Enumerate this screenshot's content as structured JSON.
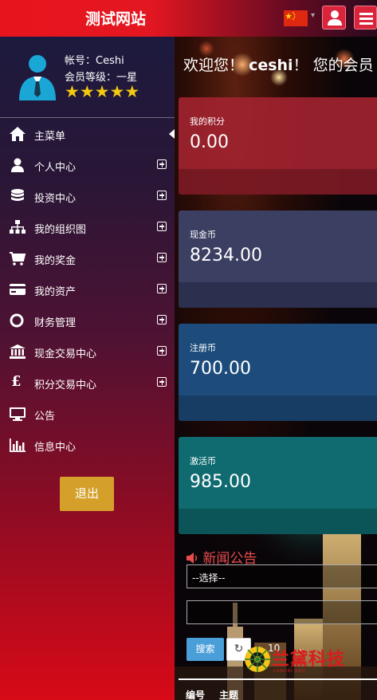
{
  "header": {
    "site_title": "测试网站"
  },
  "icons": {
    "flag": "china-flag-icon",
    "user": "user-icon",
    "menu": "hamburger-icon"
  },
  "profile": {
    "account_line": "帐号：Ceshi",
    "level_line": "会员等级：一星",
    "stars": 5
  },
  "sidebar": {
    "items": [
      {
        "label": "主菜单",
        "icon": "home-icon",
        "expandable": false,
        "active": true
      },
      {
        "label": "个人中心",
        "icon": "user-icon",
        "expandable": true
      },
      {
        "label": "投资中心",
        "icon": "database-icon",
        "expandable": true
      },
      {
        "label": "我的组织图",
        "icon": "sitemap-icon",
        "expandable": true
      },
      {
        "label": "我的奖金",
        "icon": "cart-icon",
        "expandable": true
      },
      {
        "label": "我的资产",
        "icon": "credit-card-icon",
        "expandable": true
      },
      {
        "label": "财务管理",
        "icon": "circle-icon",
        "expandable": true
      },
      {
        "label": "现金交易中心",
        "icon": "bank-icon",
        "expandable": true
      },
      {
        "label": "积分交易中心",
        "icon": "pound-icon",
        "expandable": true
      },
      {
        "label": "公告",
        "icon": "monitor-icon",
        "expandable": false
      },
      {
        "label": "信息中心",
        "icon": "bar-chart-icon",
        "expandable": false
      }
    ],
    "logout_label": "退出"
  },
  "main": {
    "welcome_prefix": "欢迎您！",
    "welcome_user": "ceshi",
    "welcome_suffix": "！  您的会员",
    "cards": [
      {
        "label": "我的积分",
        "value": "0.00",
        "color_top": "#a0232f",
        "color_bottom": "#7d1a25"
      },
      {
        "label": "现金币",
        "value": "8234.00",
        "color_top": "#3b3f62",
        "color_bottom": "#2c2f4d"
      },
      {
        "label": "注册币",
        "value": "700.00",
        "color_top": "#1d4c7c",
        "color_bottom": "#173d64"
      },
      {
        "label": "激活币",
        "value": "985.00",
        "color_top": "#0f6b70",
        "color_bottom": "#0b5558"
      }
    ],
    "news": {
      "title": "新闻公告",
      "select_placeholder": "--选择--",
      "search_label": "搜索",
      "page_size": "10",
      "columns": [
        "编号",
        "主题"
      ]
    }
  },
  "watermark": {
    "text": "兰黛科技",
    "sub": "LANDAI KEJI"
  },
  "colors": {
    "accent_red": "#e31721",
    "logout": "#d4a02a",
    "search": "#4a9fd8",
    "star": "#f3c911"
  }
}
